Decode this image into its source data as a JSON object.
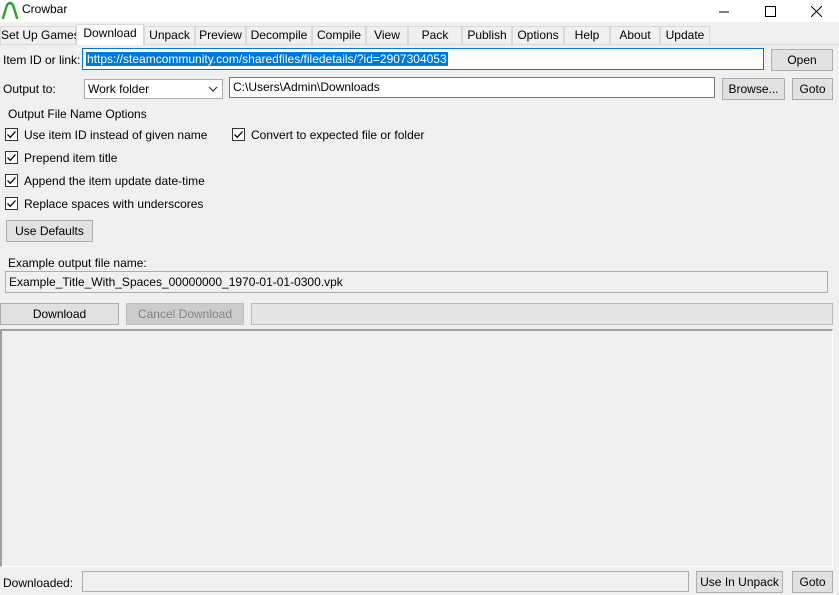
{
  "window": {
    "title": "Crowbar",
    "accent_color": "#0078d7"
  },
  "tabs": [
    {
      "label": "Set Up Games",
      "active": false
    },
    {
      "label": "Download",
      "active": true
    },
    {
      "label": "Unpack",
      "active": false
    },
    {
      "label": "Preview",
      "active": false
    },
    {
      "label": "Decompile",
      "active": false
    },
    {
      "label": "Compile",
      "active": false
    },
    {
      "label": "View",
      "active": false
    },
    {
      "label": "Pack",
      "active": false
    },
    {
      "label": "Publish",
      "active": false
    },
    {
      "label": "Options",
      "active": false
    },
    {
      "label": "Help",
      "active": false
    },
    {
      "label": "About",
      "active": false
    },
    {
      "label": "Update",
      "active": false
    }
  ],
  "download": {
    "item_label": "Item ID or link:",
    "item_value": "https://steamcommunity.com/sharedfiles/filedetails/?id=2907304053",
    "open_label": "Open",
    "output_label": "Output to:",
    "output_selected": "Work folder",
    "output_path": "C:\\Users\\Admin\\Downloads",
    "browse_label": "Browse...",
    "goto_label": "Goto",
    "options_group_title": "Output File Name Options",
    "options": [
      {
        "label": "Use item ID instead of given name",
        "checked": true
      },
      {
        "label": "Prepend item title",
        "checked": true
      },
      {
        "label": "Append the item update date-time",
        "checked": true
      },
      {
        "label": "Replace spaces with underscores",
        "checked": true
      },
      {
        "label": "Convert to expected file or folder",
        "checked": true
      }
    ],
    "use_defaults_label": "Use Defaults",
    "example_label": "Example output file name:",
    "example_value": "Example_Title_With_Spaces_00000000_1970-01-01-0300.vpk",
    "download_label": "Download",
    "cancel_label": "Cancel Download",
    "progress": 0,
    "downloaded_label": "Downloaded:",
    "downloaded_value": "",
    "use_in_unpack_label": "Use In Unpack",
    "goto2_label": "Goto"
  }
}
